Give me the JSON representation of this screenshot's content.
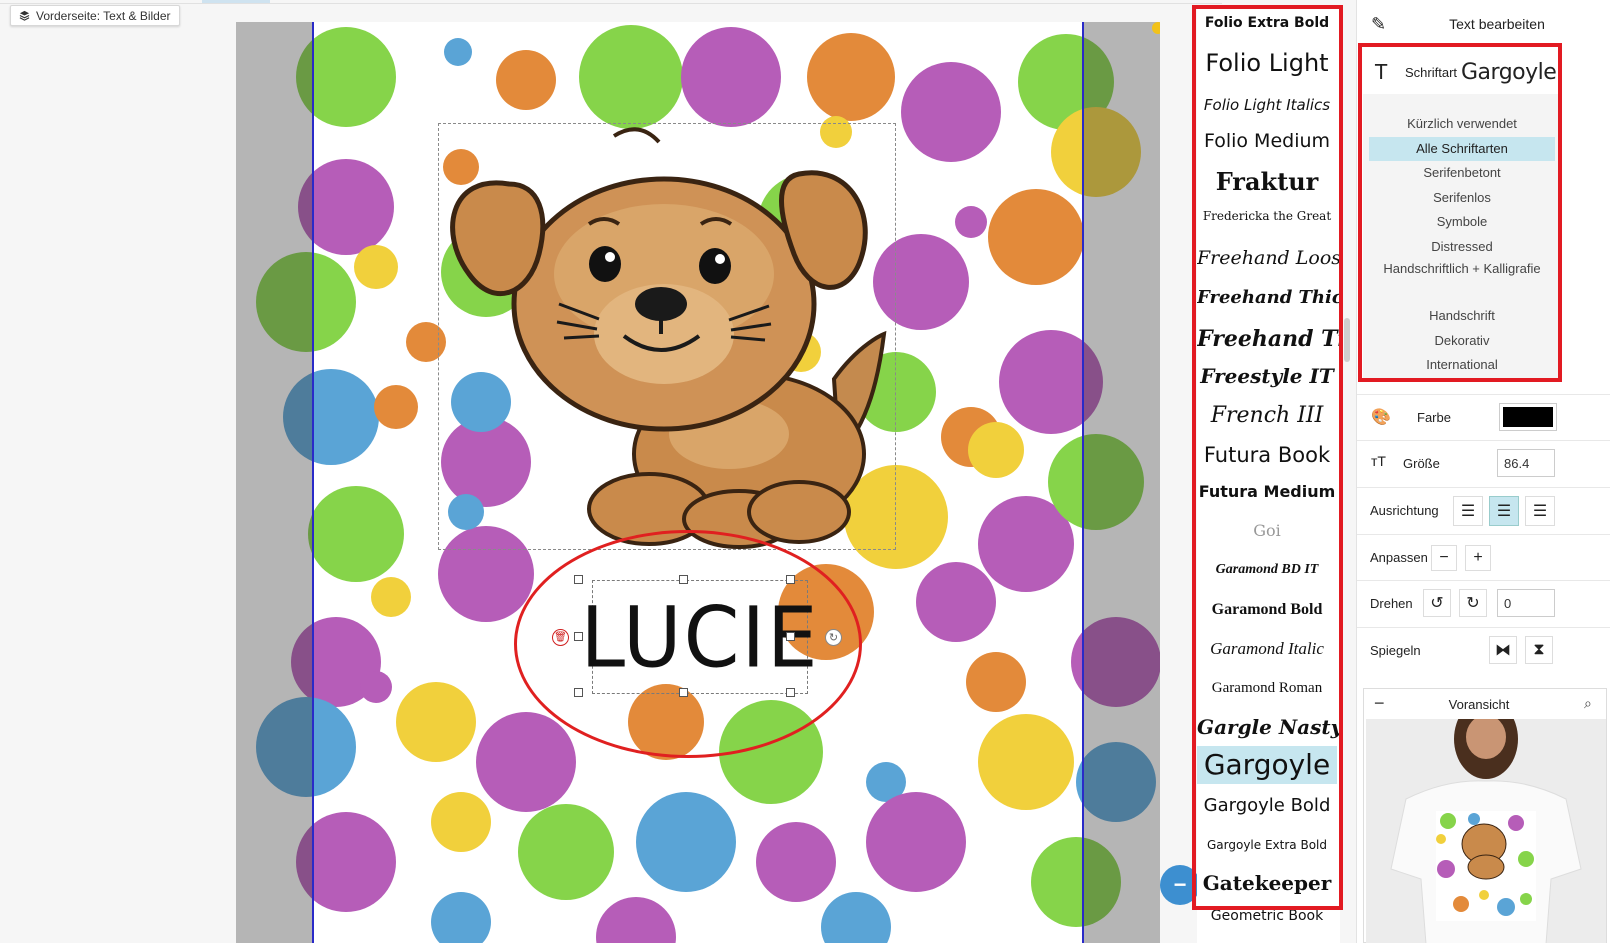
{
  "side_label": "Vorderseite: Text & Bilder",
  "canvas": {
    "name_text": "LUCIE"
  },
  "font_list": {
    "items": [
      {
        "label": "Folio Extra Bold",
        "selected": false
      },
      {
        "label": "Folio Light",
        "selected": false
      },
      {
        "label": "Folio Light Italics",
        "selected": false
      },
      {
        "label": "Folio Medium",
        "selected": false
      },
      {
        "label": "Fraktur",
        "selected": false
      },
      {
        "label": "Fredericka the Great",
        "selected": false
      },
      {
        "label": "Freehand Loose",
        "selected": false
      },
      {
        "label": "Freehand Thick",
        "selected": false
      },
      {
        "label": "Freehand Tight",
        "selected": false
      },
      {
        "label": "Freestyle IT",
        "selected": false
      },
      {
        "label": "French III",
        "selected": false
      },
      {
        "label": "Futura Book",
        "selected": false
      },
      {
        "label": "Futura Medium",
        "selected": false
      },
      {
        "label": "Goi",
        "selected": false
      },
      {
        "label": "Garamond BD IT",
        "selected": false
      },
      {
        "label": "Garamond Bold",
        "selected": false
      },
      {
        "label": "Garamond Italic",
        "selected": false
      },
      {
        "label": "Garamond Roman",
        "selected": false
      },
      {
        "label": "Gargle Nasty",
        "selected": false
      },
      {
        "label": "Gargoyle",
        "selected": true
      },
      {
        "label": "Gargoyle Bold",
        "selected": false
      },
      {
        "label": "Gargoyle Extra Bold",
        "selected": false
      },
      {
        "label": "Gatekeeper",
        "selected": false
      },
      {
        "label": "Geometric Book",
        "selected": false
      }
    ]
  },
  "panel": {
    "title": "Text bearbeiten",
    "font_label": "Schriftart",
    "font_value": "Gargoyle",
    "categories": [
      {
        "label": "Kürzlich verwendet",
        "selected": false
      },
      {
        "label": "Alle Schriftarten",
        "selected": true
      },
      {
        "label": "Serifenbetont",
        "selected": false
      },
      {
        "label": "Serifenlos",
        "selected": false
      },
      {
        "label": "Symbole",
        "selected": false
      },
      {
        "label": "Distressed",
        "selected": false
      },
      {
        "label": "Handschriftlich + Kalligrafie",
        "selected": false
      },
      {
        "label": "Handschrift",
        "selected": false
      },
      {
        "label": "Dekorativ",
        "selected": false
      },
      {
        "label": "International",
        "selected": false
      }
    ],
    "color_label": "Farbe",
    "color_value": "#000000",
    "size_label": "Größe",
    "size_value": "86.4",
    "align_label": "Ausrichtung",
    "align_selected": "center",
    "fit_label": "Anpassen",
    "fit_minus": "−",
    "fit_plus": "+",
    "rotate_label": "Drehen",
    "rotate_value": "0",
    "mirror_label": "Spiegeln",
    "preview_title": "Voransicht",
    "preview_collapse": "−"
  },
  "zoom_button": "−"
}
